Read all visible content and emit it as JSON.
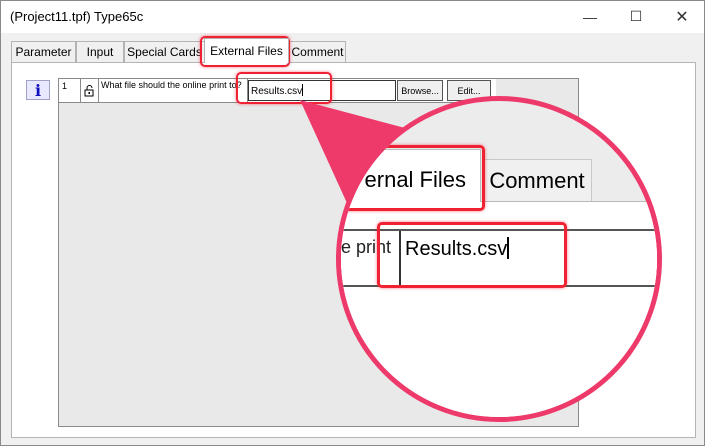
{
  "window": {
    "title": "(Project11.tpf) Type65c",
    "minimize_glyph": "—",
    "maximize_glyph": "☐",
    "close_glyph": "✕"
  },
  "tabs": [
    {
      "label": "Parameter"
    },
    {
      "label": "Input"
    },
    {
      "label": "Special Cards"
    },
    {
      "label": "External Files",
      "active": true
    },
    {
      "label": "Comment"
    }
  ],
  "info_icon": {
    "glyph": "i",
    "icon": "info-icon"
  },
  "file_row": {
    "number": "1",
    "lock_icon": "lock-icon",
    "question": "What file should the online print to?",
    "value": "Results.csv",
    "browse_label": "Browse...",
    "edit_label": "Edit..."
  },
  "magnifier": {
    "tab_active_text": "ernal Files",
    "tab_next_text": "Comment",
    "question_fragment": "e print",
    "value": "Results.csv"
  },
  "colors": {
    "highlight": "#ee2233",
    "callout": "#ee3a6a",
    "info_icon": "#1010c0"
  }
}
